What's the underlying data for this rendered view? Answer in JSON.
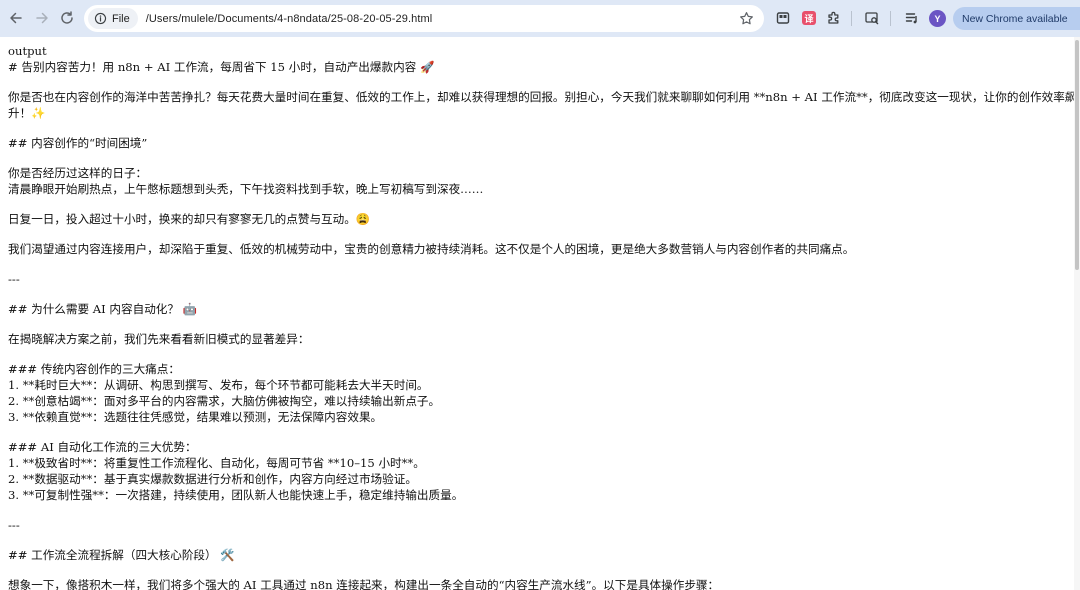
{
  "browser": {
    "chip_label": "File",
    "url": "/Users/mulele/Documents/4-n8ndata/25-08-20-05-29.html",
    "avatar_letter": "Y",
    "update_label": "New Chrome available",
    "update_menu": "⋮",
    "ext_label": "译"
  },
  "doc": {
    "lines": [
      {
        "t": "output"
      },
      {
        "t": "# 告别内容苦力！用 n8n + AI 工作流，每周省下 15 小时，自动产出爆款内容 🚀"
      },
      {
        "gap": true
      },
      {
        "t": "你是否也在内容创作的海洋中苦苦挣扎？每天花费大量时间在重复、低效的工作上，却难以获得理想的回报。别担心，今天我们就来聊聊如何利用 **n8n + AI 工作流**，彻底改变这一现状，让你的创作效率飙"
      },
      {
        "t": "升！✨"
      },
      {
        "gap": true
      },
      {
        "t": "## 内容创作的“时间困境”"
      },
      {
        "gap": true
      },
      {
        "t": "你是否经历过这样的日子："
      },
      {
        "t": "清晨睁眼开始刷热点，上午憋标题想到头秃，下午找资料找到手软，晚上写初稿写到深夜……"
      },
      {
        "gap": true
      },
      {
        "t": "日复一日，投入超过十小时，换来的却只有寥寥无几的点赞与互动。😩"
      },
      {
        "gap": true
      },
      {
        "t": "我们渴望通过内容连接用户，却深陷于重复、低效的机械劳动中，宝贵的创意精力被持续消耗。这不仅是个人的困境，更是绝大多数营销人与内容创作者的共同痛点。"
      },
      {
        "gap": true
      },
      {
        "t": "---"
      },
      {
        "gap": true
      },
      {
        "t": "## 为什么需要 AI 内容自动化？ 🤖"
      },
      {
        "gap": true
      },
      {
        "t": "在揭晓解决方案之前，我们先来看看新旧模式的显著差异："
      },
      {
        "gap": true
      },
      {
        "t": "### 传统内容创作的三大痛点："
      },
      {
        "t": "1. **耗时巨大**：从调研、构思到撰写、发布，每个环节都可能耗去大半天时间。"
      },
      {
        "t": "2. **创意枯竭**：面对多平台的内容需求，大脑仿佛被掏空，难以持续输出新点子。"
      },
      {
        "t": "3. **依赖直觉**：选题往往凭感觉，结果难以预测，无法保障内容效果。"
      },
      {
        "gap": true
      },
      {
        "t": "### AI 自动化工作流的三大优势："
      },
      {
        "t": "1. **极致省时**：将重复性工作流程化、自动化，每周可节省 **10–15 小时**。"
      },
      {
        "t": "2. **数据驱动**：基于真实爆款数据进行分析和创作，内容方向经过市场验证。"
      },
      {
        "t": "3. **可复制性强**：一次搭建，持续使用，团队新人也能快速上手，稳定维持输出质量。"
      },
      {
        "gap": true
      },
      {
        "t": "---"
      },
      {
        "gap": true
      },
      {
        "t": "## 工作流全流程拆解（四大核心阶段） 🛠️"
      },
      {
        "gap": true
      },
      {
        "t": "想象一下，像搭积木一样，我们将多个强大的 AI 工具通过 n8n 连接起来，构建出一条全自动的“内容生产流水线”。以下是具体操作步骤："
      }
    ]
  }
}
